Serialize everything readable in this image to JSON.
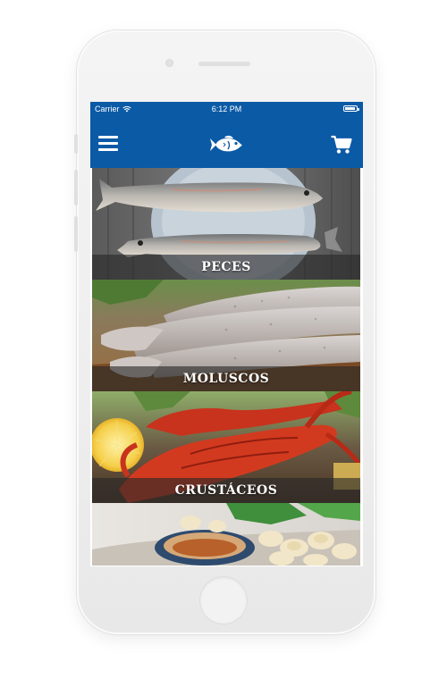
{
  "status_bar": {
    "carrier": "Carrier",
    "time": "6:12 PM",
    "battery_level": 0.9
  },
  "nav_bar": {
    "menu_icon": "hamburger-menu-icon",
    "logo_icon": "fish-logo-icon",
    "cart_icon": "shopping-cart-icon"
  },
  "categories": [
    {
      "label": "PECES",
      "image": "fish-photo"
    },
    {
      "label": "MOLUSCOS",
      "image": "squid-photo"
    },
    {
      "label": "CRUSTÁCEOS",
      "image": "lobster-photo"
    },
    {
      "label": "",
      "image": "prepared-dish-photo"
    }
  ],
  "colors": {
    "accent": "#0b5aa6",
    "label_band": "#282828",
    "phone_body": "#f0f0f0"
  }
}
